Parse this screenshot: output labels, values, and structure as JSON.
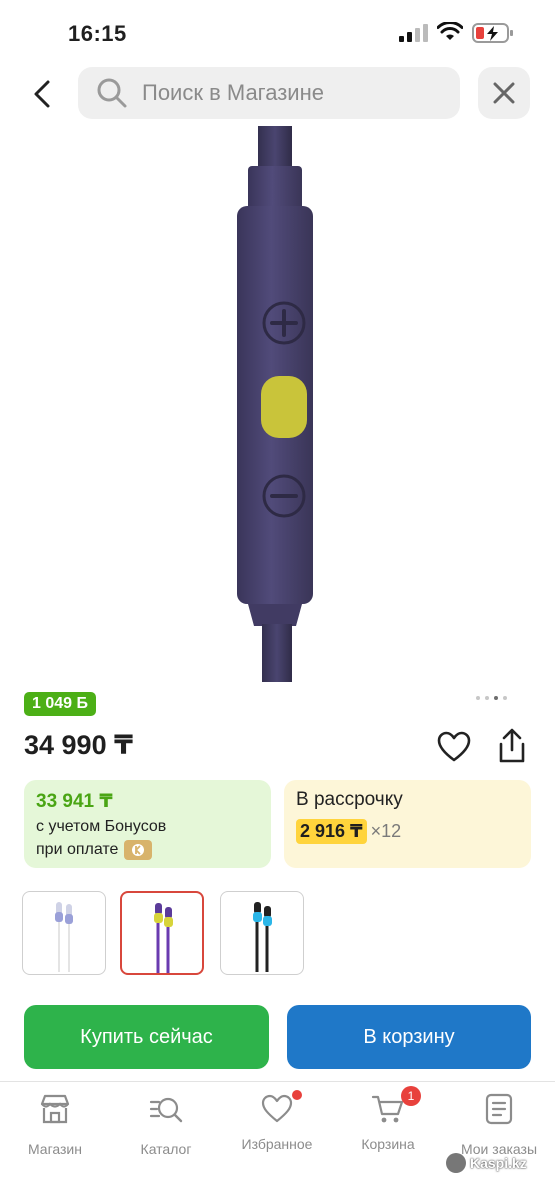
{
  "status": {
    "time": "16:15"
  },
  "search": {
    "placeholder": "Поиск в Магазине"
  },
  "product": {
    "bonus": "1 049 Б",
    "price": "34 990 ₸",
    "gallery_dots": 4,
    "gallery_active_index": 2
  },
  "bonus_card": {
    "amount": "33 941 ₸",
    "line1": "с учетом Бонусов",
    "line2": "при оплате"
  },
  "installment_card": {
    "title": "В рассрочку",
    "monthly": "2 916 ₸",
    "multiplier": "×12"
  },
  "variants": [
    {
      "color": "white",
      "selected": false
    },
    {
      "color": "purple",
      "selected": true
    },
    {
      "color": "blue",
      "selected": false
    }
  ],
  "actions": {
    "buy": "Купить сейчас",
    "cart": "В корзину"
  },
  "tabbar": {
    "items": [
      {
        "label": "Магазин",
        "icon": "store-icon"
      },
      {
        "label": "Каталог",
        "icon": "catalog-search-icon"
      },
      {
        "label": "Избранное",
        "icon": "heart-icon"
      },
      {
        "label": "Корзина",
        "icon": "cart-icon"
      },
      {
        "label": "Мои заказы",
        "icon": "orders-icon"
      }
    ],
    "cart_badge": "1"
  },
  "watermark": "Kaspi.kz",
  "colors": {
    "buy_green": "#2eb34b",
    "cart_blue": "#1f78c8",
    "bonus_green": "#4caf16",
    "installment_yellow": "#ffd43c",
    "accent_red": "#e8413c"
  }
}
